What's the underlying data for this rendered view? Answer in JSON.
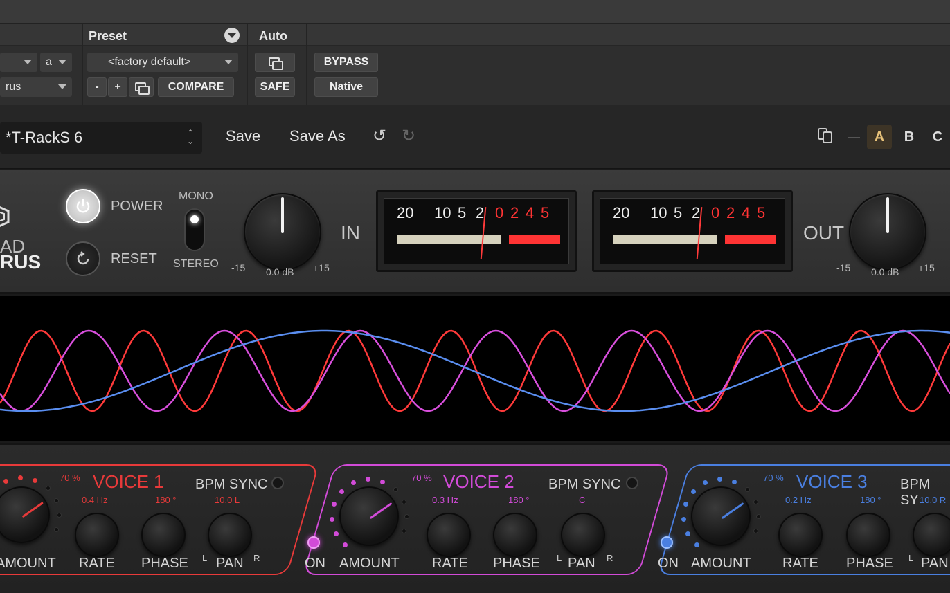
{
  "host": {
    "preset_label": "Preset",
    "auto_label": "Auto",
    "track_dropdown_suffix": "a",
    "insert_dropdown": "rus",
    "preset_dropdown": "<factory default>",
    "minus": "-",
    "plus": "+",
    "compare": "COMPARE",
    "safe": "SAFE",
    "bypass": "BYPASS",
    "native": "Native"
  },
  "header": {
    "preset_name": "*T-RackS 6",
    "save": "Save",
    "save_as": "Save As",
    "slot_a": "A",
    "slot_b": "B",
    "slot_c": "C"
  },
  "plugin": {
    "logo_line1": "AD",
    "logo_line2": "RUS",
    "power": "POWER",
    "reset": "RESET",
    "mono": "MONO",
    "stereo": "STEREO",
    "in_label": "IN",
    "out_label": "OUT",
    "in_min": "-15",
    "in_max": "+15",
    "in_value": "0.0 dB",
    "out_min": "-15",
    "out_max": "+15",
    "out_value": "0.0 dB",
    "meter_scale_white": [
      "20",
      "10",
      "5",
      "2"
    ],
    "meter_scale_red": [
      "0",
      "2",
      "4",
      "5"
    ]
  },
  "voices": [
    {
      "title": "VOICE 1",
      "color": "#e83a3a",
      "amount_pct": "70 %",
      "bpm_sync": "BPM SYNC",
      "rate_val": "0.4 Hz",
      "phase_val": "180 °",
      "pan_val": "10.0 L",
      "amount": "AMOUNT",
      "rate": "RATE",
      "phase": "PHASE",
      "pan": "PAN",
      "pan_l": "L",
      "pan_r": "R"
    },
    {
      "title": "VOICE 2",
      "color": "#d24bd8",
      "amount_pct": "70 %",
      "bpm_sync": "BPM SYNC",
      "rate_val": "0.3 Hz",
      "phase_val": "180 °",
      "pan_val": "C",
      "on": "ON",
      "amount": "AMOUNT",
      "rate": "RATE",
      "phase": "PHASE",
      "pan": "PAN",
      "pan_l": "L",
      "pan_r": "R"
    },
    {
      "title": "VOICE 3",
      "color": "#4a7fe0",
      "amount_pct": "70 %",
      "bpm_sync": "BPM SY",
      "rate_val": "0.2 Hz",
      "phase_val": "180 °",
      "pan_val": "10.0 R",
      "on": "ON",
      "amount": "AMOUNT",
      "rate": "RATE",
      "phase": "PHASE",
      "pan": "PAN",
      "pan_l": "L"
    }
  ]
}
